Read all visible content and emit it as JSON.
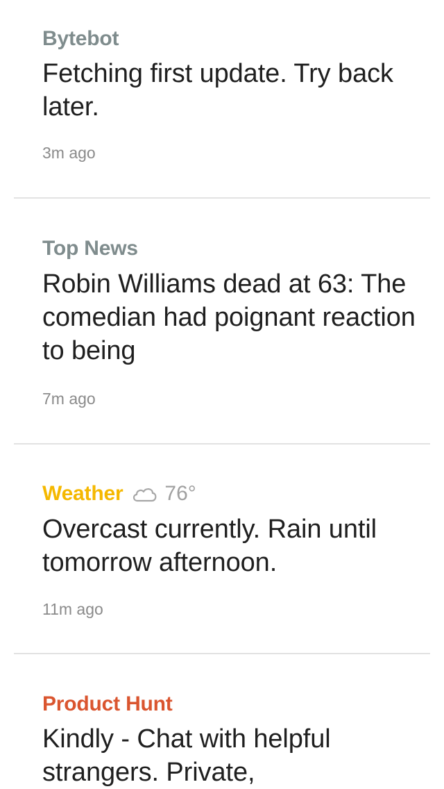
{
  "cards": [
    {
      "source": "Bytebot",
      "source_color": "#7f8c8d",
      "body": "Fetching first update. Try back later.",
      "time": "3m ago"
    },
    {
      "source": "Top News",
      "source_color": "#7f8c8d",
      "body": "Robin Williams dead at 63: The comedian had poignant reaction to being",
      "time": "7m ago"
    },
    {
      "source": "Weather",
      "source_color": "#f5b800",
      "icon": "cloud-icon",
      "temperature": "76°",
      "body": "Overcast currently. Rain until tomorrow afternoon.",
      "time": "11m ago"
    },
    {
      "source": "Product Hunt",
      "source_color": "#da552f",
      "body": "Kindly - Chat with helpful strangers. Private,"
    }
  ]
}
